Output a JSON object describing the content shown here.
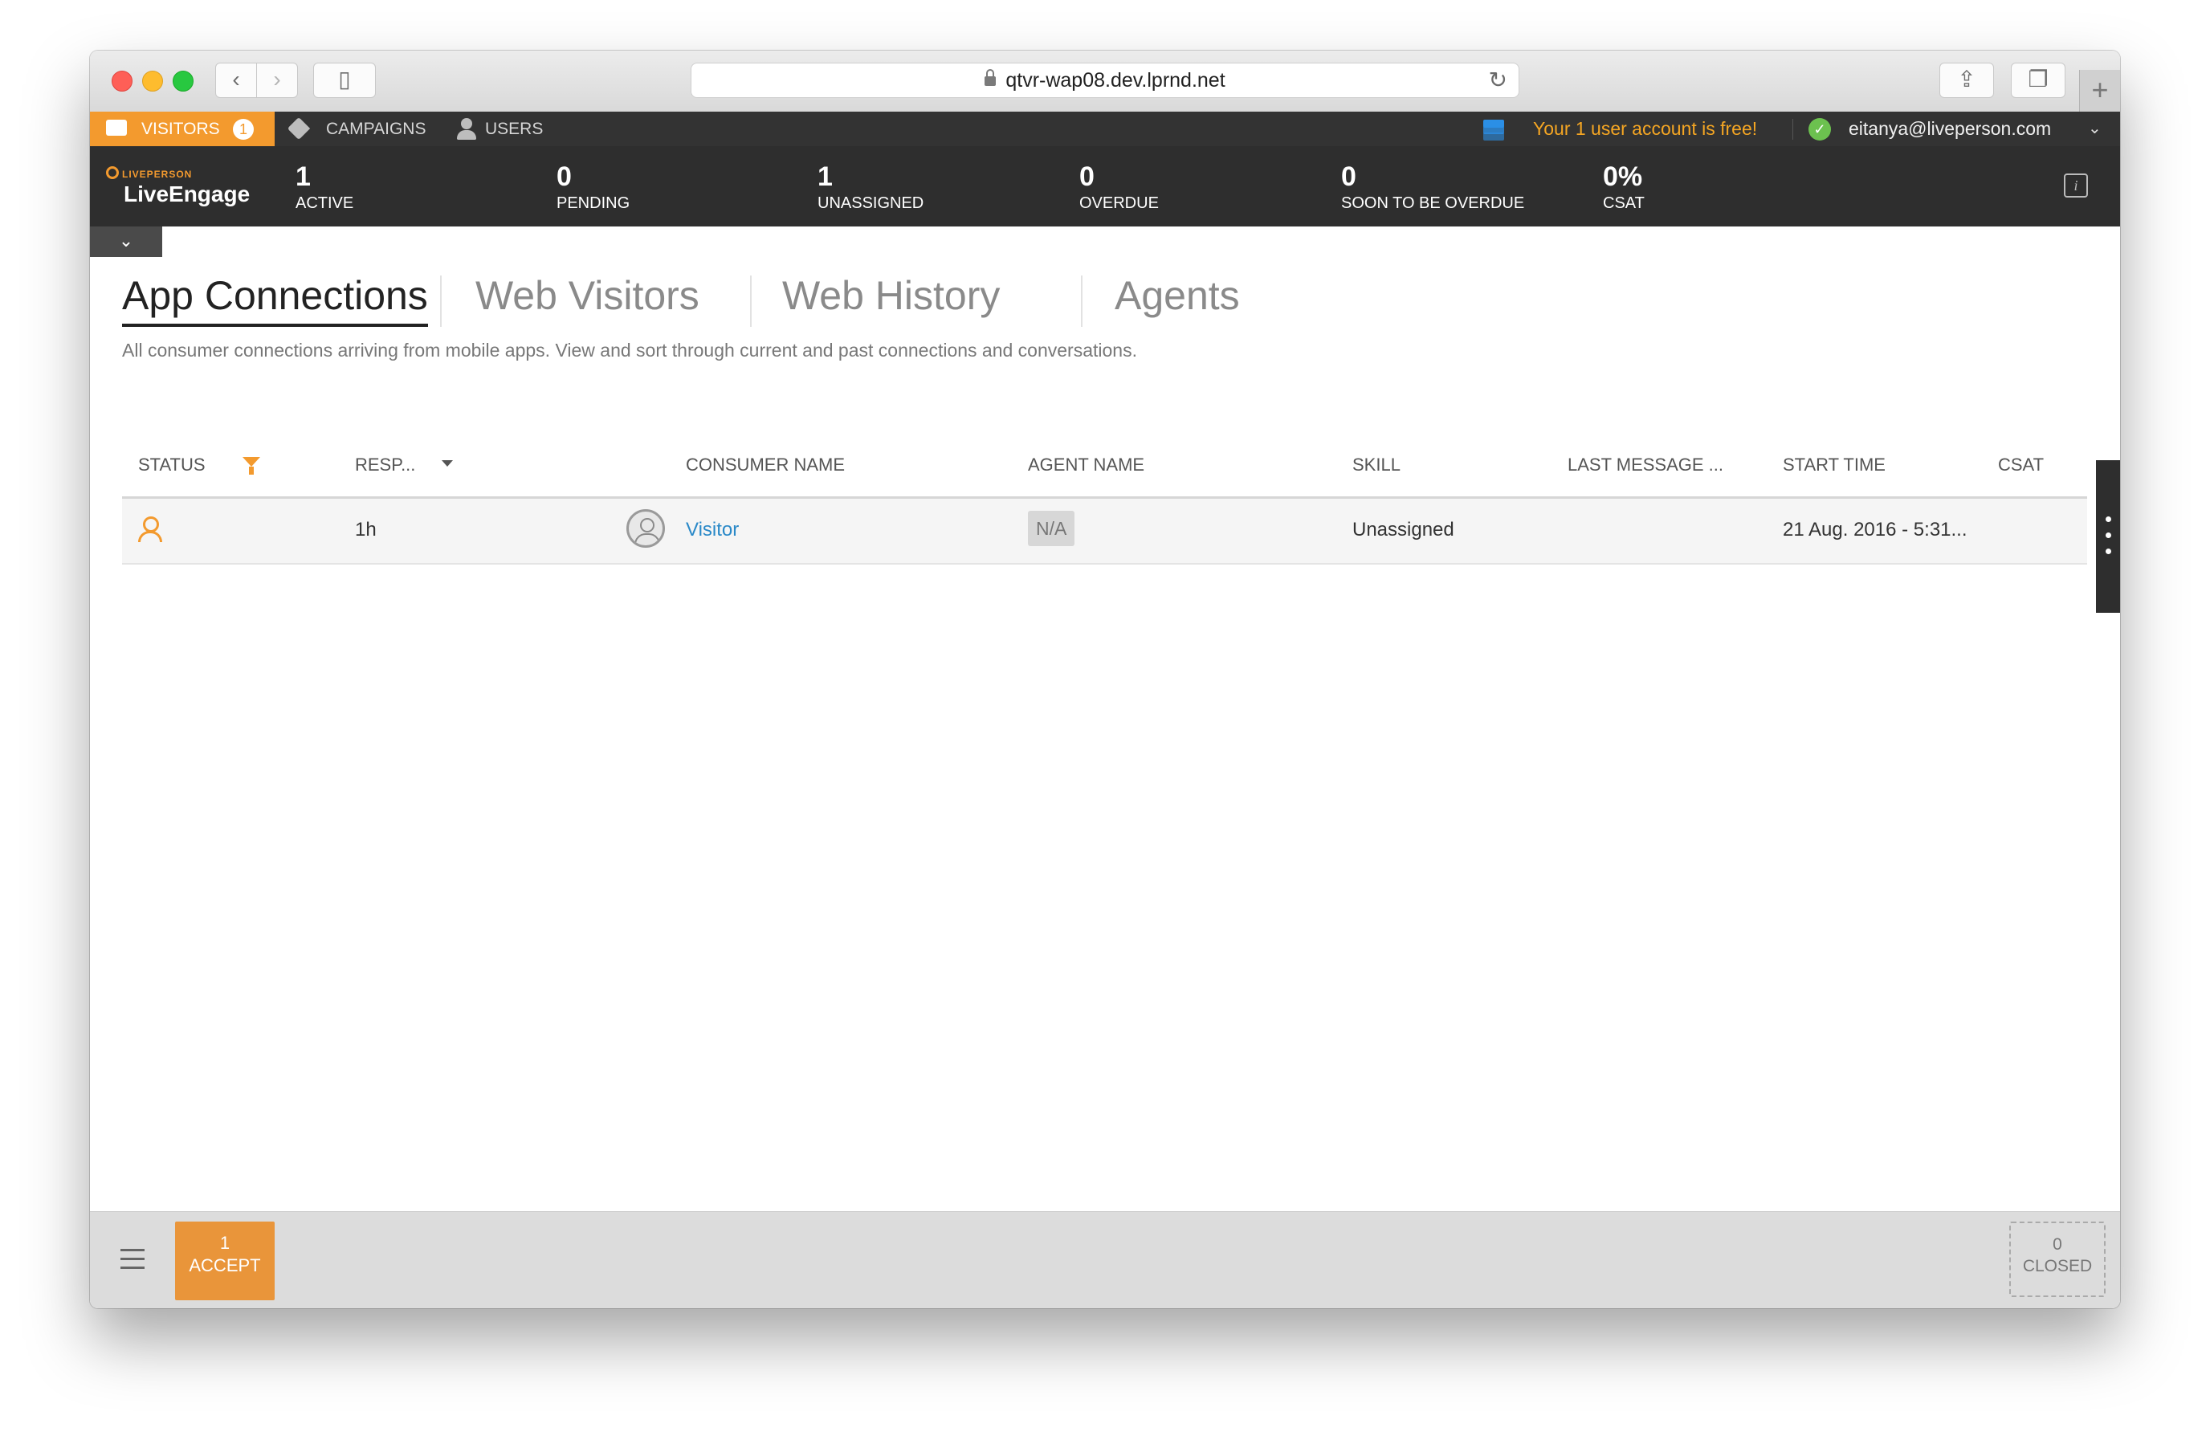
{
  "browser": {
    "url": "qtvr-wap08.dev.lprnd.net",
    "new_tab": "+"
  },
  "nav": {
    "visitors_label": "VISITORS",
    "visitors_count": "1",
    "campaigns_label": "CAMPAIGNS",
    "users_label": "USERS",
    "free_message": "Your 1 user account is free!",
    "user_email": "eitanya@liveperson.com"
  },
  "brand": {
    "small": "LIVEPERSON",
    "big": "LiveEngage"
  },
  "stats": [
    {
      "value": "1",
      "label": "ACTIVE"
    },
    {
      "value": "0",
      "label": "PENDING"
    },
    {
      "value": "1",
      "label": "UNASSIGNED"
    },
    {
      "value": "0",
      "label": "OVERDUE"
    },
    {
      "value": "0",
      "label": "SOON TO BE OVERDUE"
    },
    {
      "value": "0%",
      "label": "CSAT"
    }
  ],
  "tabs": [
    {
      "label": "App Connections",
      "active": true
    },
    {
      "label": "Web Visitors",
      "active": false
    },
    {
      "label": "Web History",
      "active": false
    },
    {
      "label": "Agents",
      "active": false
    }
  ],
  "description": "All consumer connections arriving from mobile apps. View and sort through current and past connections and conversations.",
  "table": {
    "columns": [
      "STATUS",
      "RESP...",
      "CONSUMER NAME",
      "AGENT NAME",
      "SKILL",
      "LAST MESSAGE ...",
      "START TIME",
      "CSAT"
    ],
    "rows": [
      {
        "status_icon": "person-icon",
        "response": "1h",
        "consumer_name": "Visitor",
        "agent_name": "N/A",
        "skill": "Unassigned",
        "last_message": "",
        "start_time": "21 Aug. 2016 - 5:31...",
        "csat": ""
      }
    ]
  },
  "bottom": {
    "accept_count": "1",
    "accept_label": "ACCEPT",
    "closed_count": "0",
    "closed_label": "CLOSED"
  },
  "colors": {
    "accent_orange": "#f39a2e",
    "dark_bar": "#2e2e2e",
    "link_blue": "#2a89c8",
    "free_msg": "#f5a623",
    "online_green": "#6cc14f"
  }
}
